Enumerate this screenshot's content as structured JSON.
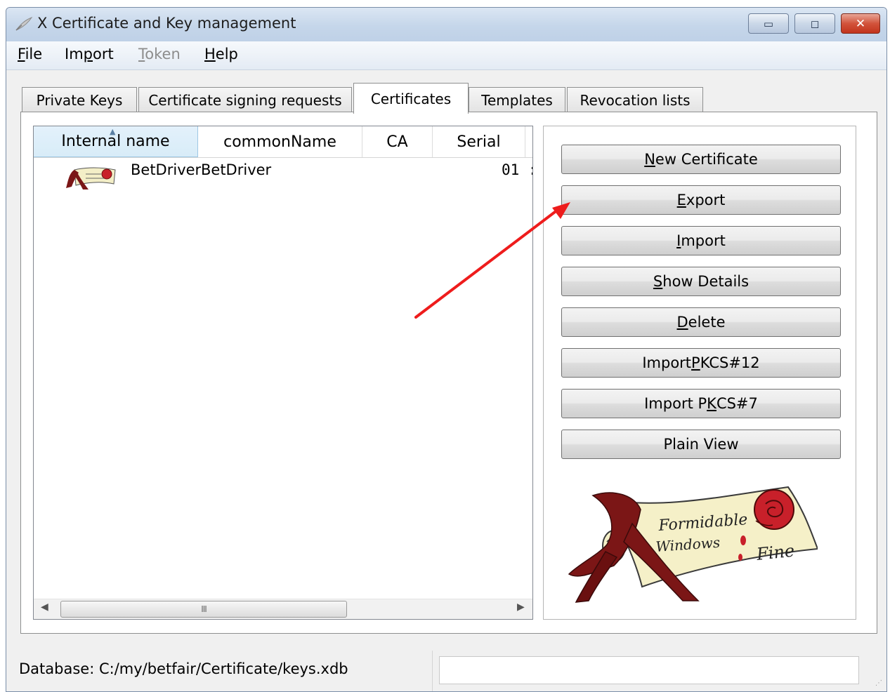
{
  "window": {
    "title": "X Certificate and Key management",
    "controls": {
      "minimize": "▭",
      "maximize": "◻",
      "close": "✕"
    }
  },
  "menu": {
    "file": {
      "mnemonic": "F",
      "rest": "ile"
    },
    "import": {
      "pre": "Im",
      "mnemonic": "p",
      "rest": "ort"
    },
    "token": {
      "mnemonic": "T",
      "rest": "oken",
      "disabled": true
    },
    "help": {
      "mnemonic": "H",
      "rest": "elp"
    }
  },
  "tabs": [
    {
      "label": "Private Keys"
    },
    {
      "label": "Certificate signing requests"
    },
    {
      "label": "Certificates",
      "active": true
    },
    {
      "label": "Templates"
    },
    {
      "label": "Revocation lists"
    }
  ],
  "table": {
    "columns": [
      "Internal name",
      "commonName",
      "CA",
      "Serial"
    ],
    "sorted_column": "Internal name",
    "rows": [
      {
        "internal_name": "BetDriver",
        "common_name": "BetDriver",
        "ca": "",
        "serial": "01 :"
      }
    ],
    "scrollbar": {
      "thumb_grip": "III",
      "left_arrow": "◀",
      "right_arrow": "▶"
    }
  },
  "buttons": {
    "new_certificate": {
      "pre": "",
      "mnemonic": "N",
      "rest": "ew Certificate"
    },
    "export": {
      "pre": "",
      "mnemonic": "E",
      "rest": "xport"
    },
    "import": {
      "pre": "",
      "mnemonic": "I",
      "rest": "mport"
    },
    "show_details": {
      "pre": "",
      "mnemonic": "S",
      "rest": "how Details"
    },
    "delete": {
      "pre": "",
      "mnemonic": "D",
      "rest": "elete"
    },
    "import_pkcs12": {
      "pre": "Import ",
      "mnemonic": "P",
      "rest": "KCS#12"
    },
    "import_pkcs7": {
      "pre": "Import P",
      "mnemonic": "K",
      "rest": "CS#7"
    },
    "plain_view": {
      "pre": "",
      "mnemonic": "",
      "rest": "Plain View"
    }
  },
  "logo": {
    "text_line1": "Formidable",
    "text_line2": "Windows",
    "text_line3": "Fine"
  },
  "status": {
    "database_text": "Database: C:/my/betfair/Certificate/keys.xdb",
    "grip": "⋰"
  },
  "colors": {
    "annotation_arrow": "#ee1c1c",
    "ribbon": "#7b1616",
    "rose": "#c8202a",
    "parchment": "#f5f0c8"
  }
}
